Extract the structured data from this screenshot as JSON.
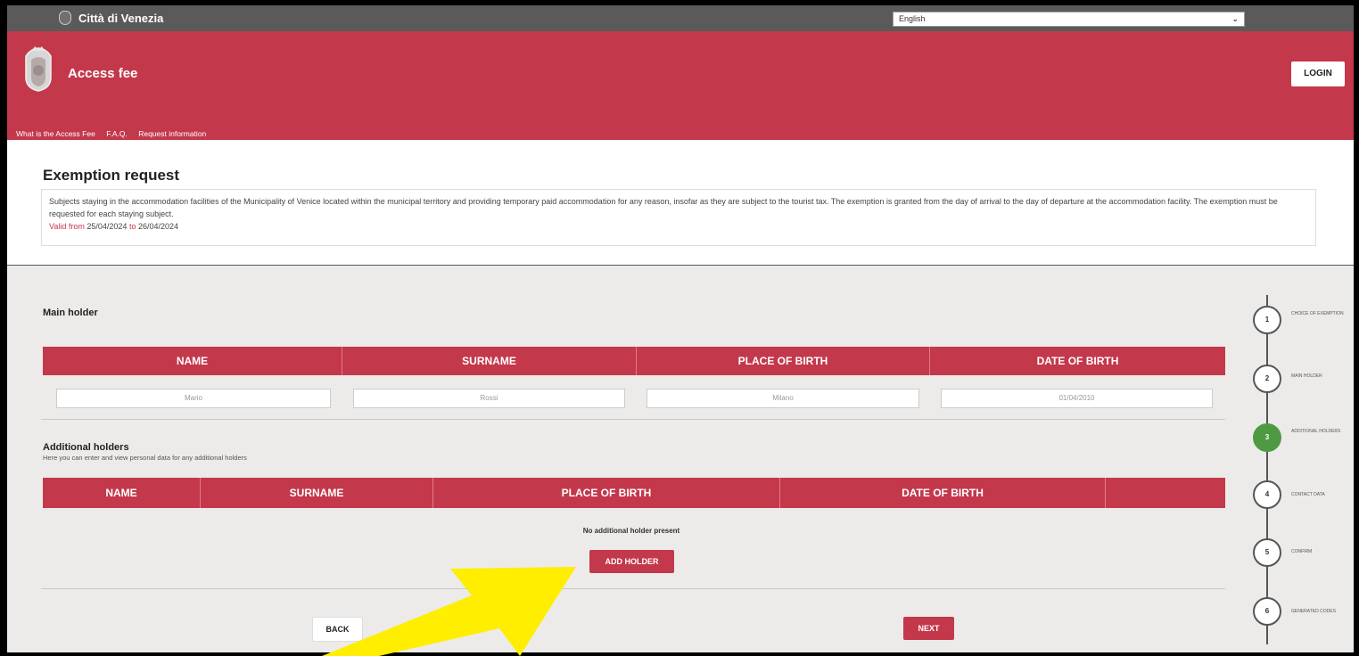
{
  "topbar": {
    "city_name": "Città di Venezia",
    "language": "English"
  },
  "header": {
    "title": "Access fee",
    "login_label": "LOGIN"
  },
  "nav": [
    "What is the Access Fee",
    "F.A.Q.",
    "Request information"
  ],
  "intro": {
    "title": "Exemption request",
    "description": "Subjects staying in the accommodation facilities of the Municipality of Venice located within the municipal territory and providing temporary paid accommodation for any reason, insofar as they are subject to the tourist tax. The exemption is granted from the day of arrival to the day of departure at the accommodation facility. The exemption must be requested for each staying subject.",
    "valid_from_label": "Valid from",
    "valid_from": "25/04/2024",
    "valid_to_label": "to",
    "valid_to": "26/04/2024"
  },
  "main_holder": {
    "title": "Main holder",
    "columns": [
      "NAME",
      "SURNAME",
      "PLACE OF BIRTH",
      "DATE OF BIRTH"
    ],
    "values": [
      "Mario",
      "Rossi",
      "Milano",
      "01/04/2010"
    ]
  },
  "additional_holders": {
    "title": "Additional holders",
    "subtitle": "Here you can enter and view personal data for any additional holders",
    "columns": [
      "NAME",
      "SURNAME",
      "PLACE OF BIRTH",
      "DATE OF BIRTH",
      ""
    ],
    "empty_text": "No additional holder present",
    "add_label": "ADD HOLDER"
  },
  "footer": {
    "back_label": "BACK",
    "next_label": "NEXT"
  },
  "steps": [
    {
      "number": "1",
      "label": "CHOICE OF EXEMPTION",
      "active": false
    },
    {
      "number": "2",
      "label": "MAIN HOLDER",
      "active": false
    },
    {
      "number": "3",
      "label": "ADDITIONAL HOLDERS",
      "active": true
    },
    {
      "number": "4",
      "label": "CONTACT DATA",
      "active": false
    },
    {
      "number": "5",
      "label": "CONFIRM",
      "active": false
    },
    {
      "number": "6",
      "label": "GENERATED CODES",
      "active": false
    }
  ],
  "colors": {
    "brand": "#c3384b",
    "active_step": "#4e9a42",
    "annotation_arrow": "#ffee00"
  }
}
